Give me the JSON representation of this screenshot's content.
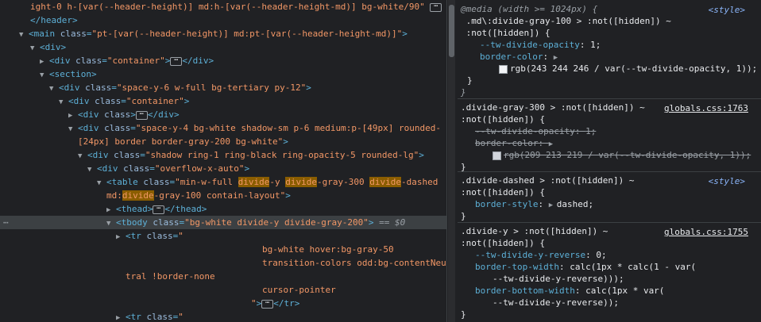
{
  "elements": {
    "l0": "ight-0 h-[var(--header-height)] md:h-[var(--header-height-md)] bg-white/90\"",
    "l1_tag": "</header>",
    "l2_tag_open": "<main ",
    "l2_attr": "class",
    "l2_val": "\"pt-[var(--header-height)] md:pt-[var(--header-height-md)]\"",
    "l3": "<div>",
    "l4_attr_val": "\"container\"",
    "l4_close": "</div>",
    "l5": "<section>",
    "l6_val": "\"space-y-6 w-full bg-tertiary py-12\"",
    "l7_val": "\"container\"",
    "l8_close": "</div>",
    "l9_val": "\"space-y-4 bg-white shadow-sm p-6 medium:p-[49px] rounded-",
    "l10_val": "[24px] border border-gray-200 bg-white\"",
    "l11_val": "\"shadow ring-1 ring-black ring-opacity-5 rounded-lg\"",
    "l12_val": "\"overflow-x-auto\"",
    "l13_val_a": "\"min-w-full ",
    "l13_hl1": "divide",
    "l13_val_b": "-y ",
    "l13_hl2": "divide",
    "l13_val_c": "-gray-300 ",
    "l13_hl3": "divide",
    "l13_val_d": "-dashed",
    "l14_val_a": "md:",
    "l14_hl": "divide",
    "l14_val_b": "-gray-100 contain-layout\"",
    "l15_open": "<thead>",
    "l15_close": "</thead>",
    "l16_tag": "<tbody ",
    "l16_val": "\"bg-white divide-y divide-gray-200\"",
    "l16_eq": "== $0",
    "l17_tag": "<tr ",
    "l17_val": "\"",
    "l18": "bg-white hover:bg-gray-50",
    "l19": "transition-colors odd:bg-contentNeu",
    "l20": "tral !border-none",
    "l21": "cursor-pointer",
    "l22_q": "\"",
    "l22_close": "</tr>",
    "l23_tag": "<tr ",
    "l23_val": "\""
  },
  "styles": {
    "r1": {
      "media": "@media (width >= 1024px) {",
      "sel_a": " .md\\:divide-gray-100 > :not([hidden]) ~",
      "sel_b": " :not([hidden]) {",
      "p1n": "--tw-divide-opacity",
      "p1v": "1",
      "p2n": "border-color",
      "p2v": "rgb(243 244 246 / var(--tw-divide-opacity, 1));",
      "source": "<style>"
    },
    "r2": {
      "sel_a": ".divide-gray-300 > :not([hidden]) ~",
      "sel_b": ":not([hidden]) {",
      "p1n": "--tw-divide-opacity",
      "p1v": "1",
      "p2n": "border-color",
      "p2v": "rgb(209 213 219 / var(--tw-divide-opacity, 1));",
      "source": "globals.css:1763"
    },
    "r3": {
      "sel_a": ".divide-dashed > :not([hidden]) ~",
      "sel_b": ":not([hidden]) {",
      "p1n": "border-style",
      "p1v": "dashed",
      "source": "<style>"
    },
    "r4": {
      "sel_a": ".divide-y > :not([hidden]) ~",
      "sel_b": ":not([hidden]) {",
      "p1n": "--tw-divide-y-reverse",
      "p1v": "0",
      "p2n": "border-top-width",
      "p2v": "calc(1px * calc(1 - var(",
      "p2v2": "--tw-divide-y-reverse)));",
      "p3n": "border-bottom-width",
      "p3v": "calc(1px * var(",
      "p3v2": "--tw-divide-y-reverse));",
      "source": "globals.css:1755"
    },
    "colors": {
      "r1_swatch": "#f3f4f6",
      "r2_swatch": "#d1d5db"
    }
  }
}
